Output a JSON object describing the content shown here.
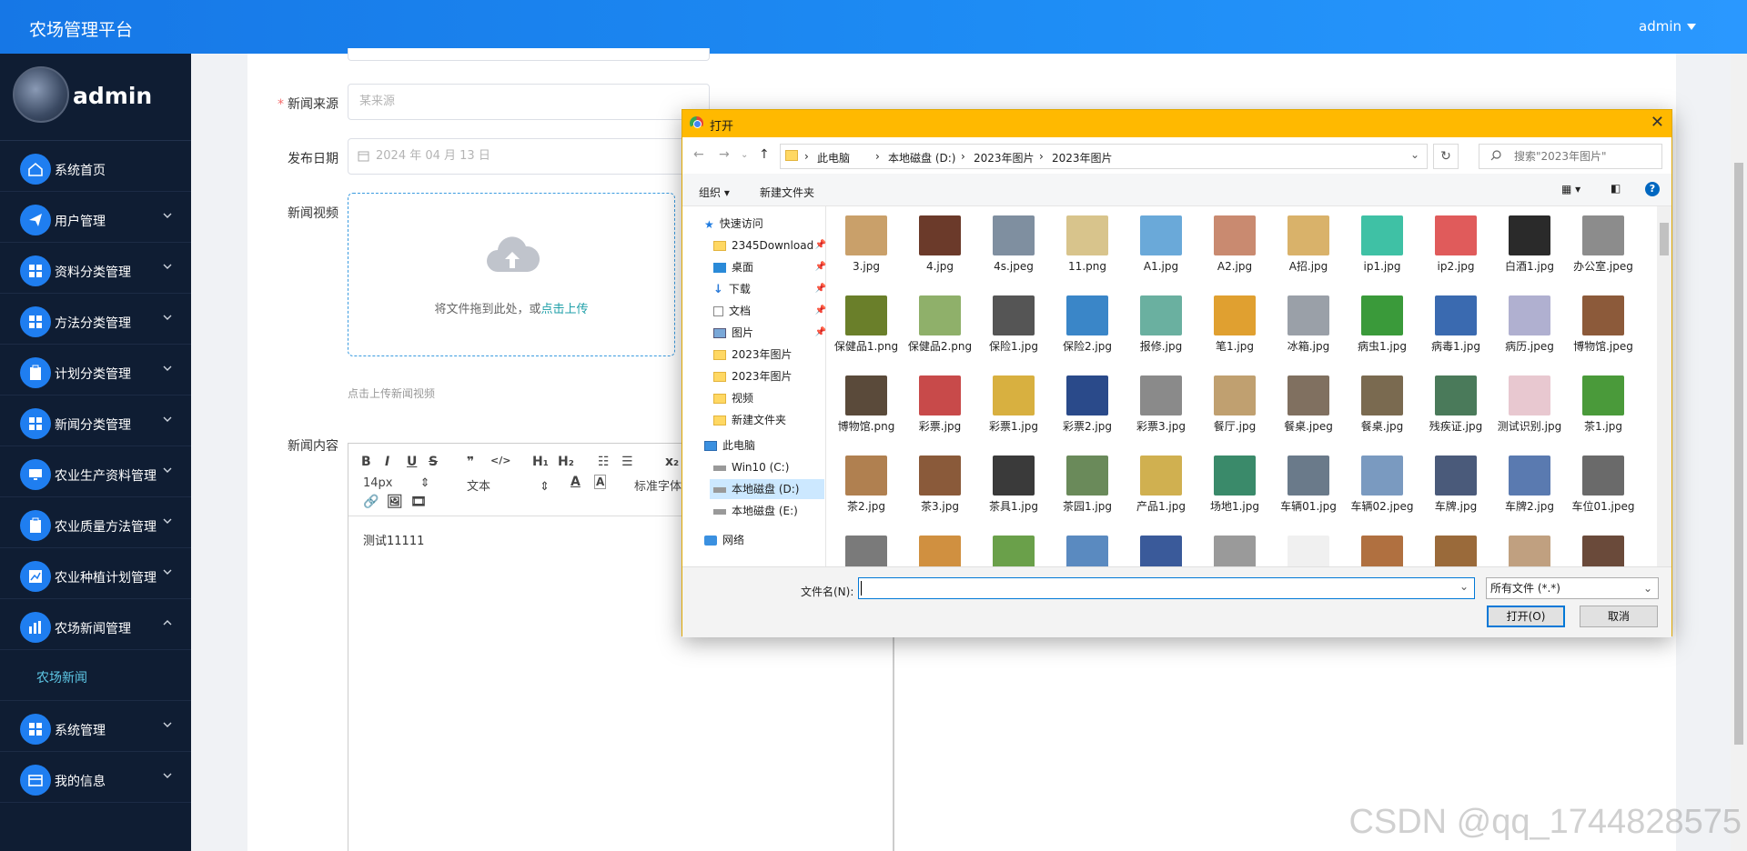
{
  "topbar": {
    "brand": "农场管理平台",
    "user": "admin"
  },
  "sidebar": {
    "profile_name": "admin",
    "items": [
      {
        "label": "系统首页",
        "icon": "home-icon"
      },
      {
        "label": "用户管理",
        "icon": "send-icon"
      },
      {
        "label": "资料分类管理",
        "icon": "grid-icon"
      },
      {
        "label": "方法分类管理",
        "icon": "grid-icon"
      },
      {
        "label": "计划分类管理",
        "icon": "clipboard-icon"
      },
      {
        "label": "新闻分类管理",
        "icon": "grid-icon"
      },
      {
        "label": "农业生产资料管理",
        "icon": "monitor-icon"
      },
      {
        "label": "农业质量方法管理",
        "icon": "clipboard-icon"
      },
      {
        "label": "农业种植计划管理",
        "icon": "chart-icon"
      },
      {
        "label": "农场新闻管理",
        "icon": "chart-bar-icon"
      }
    ],
    "sub_item": "农场新闻",
    "after_items": [
      {
        "label": "系统管理",
        "icon": "grid-icon"
      },
      {
        "label": "我的信息",
        "icon": "card-icon"
      }
    ]
  },
  "form": {
    "source_label": "新闻来源",
    "source_placeholder": "某来源",
    "date_label": "发布日期",
    "date_value": "2024 年 04 月 13 日",
    "video_label": "新闻视频",
    "upload_text": "将文件拖到此处，或",
    "upload_link": "点击上传",
    "upload_tip": "点击上传新闻视频",
    "content_label": "新闻内容",
    "editor_font_size": "14px",
    "editor_text_type": "文本",
    "editor_font_family": "标准字体",
    "editor_content": "测试11111"
  },
  "dialog": {
    "title": "打开",
    "breadcrumbs": [
      "此电脑",
      "本地磁盘 (D:)",
      "2023年图片",
      "2023年图片"
    ],
    "search_placeholder": "搜索\"2023年图片\"",
    "organize": "组织 ▾",
    "new_folder": "新建文件夹",
    "tree": [
      {
        "label": "快速访问",
        "type": "star",
        "indent": 0
      },
      {
        "label": "2345Download",
        "type": "folder",
        "indent": 1,
        "pin": true
      },
      {
        "label": "桌面",
        "type": "desktop",
        "indent": 1,
        "pin": true
      },
      {
        "label": "下载",
        "type": "download",
        "indent": 1,
        "pin": true
      },
      {
        "label": "文档",
        "type": "doc",
        "indent": 1,
        "pin": true
      },
      {
        "label": "图片",
        "type": "pic",
        "indent": 1,
        "pin": true
      },
      {
        "label": "2023年图片",
        "type": "folder",
        "indent": 1
      },
      {
        "label": "2023年图片",
        "type": "folder",
        "indent": 1
      },
      {
        "label": "视频",
        "type": "folder",
        "indent": 1
      },
      {
        "label": "新建文件夹",
        "type": "folder",
        "indent": 1
      },
      {
        "label": "此电脑",
        "type": "pc",
        "indent": 0
      },
      {
        "label": "Win10 (C:)",
        "type": "drive",
        "indent": 1
      },
      {
        "label": "本地磁盘 (D:)",
        "type": "drive",
        "indent": 1,
        "selected": true
      },
      {
        "label": "本地磁盘 (E:)",
        "type": "drive",
        "indent": 1
      },
      {
        "label": "网络",
        "type": "net",
        "indent": 0
      }
    ],
    "files": [
      [
        "3.jpg",
        "4.jpg",
        "4s.jpeg",
        "11.png",
        "A1.jpg",
        "A2.jpg",
        "A招.jpg",
        "ip1.jpg",
        "ip2.jpg",
        "白酒1.jpg",
        "办公室.jpeg"
      ],
      [
        "保健品1.png",
        "保健品2.png",
        "保险1.jpg",
        "保险2.jpg",
        "报修.jpg",
        "笔1.jpg",
        "冰箱.jpg",
        "病虫1.jpg",
        "病毒1.jpg",
        "病历.jpeg",
        "博物馆.jpeg"
      ],
      [
        "博物馆.png",
        "彩票.jpg",
        "彩票1.jpg",
        "彩票2.jpg",
        "彩票3.jpg",
        "餐厅.jpg",
        "餐桌.jpeg",
        "餐桌.jpg",
        "残疾证.jpg",
        "测试识别.jpg",
        "茶1.jpg"
      ],
      [
        "茶2.jpg",
        "茶3.jpg",
        "茶具1.jpg",
        "茶园1.jpg",
        "产品1.jpg",
        "场地1.jpg",
        "车辆01.jpg",
        "车辆02.jpeg",
        "车牌.jpg",
        "车牌2.jpg",
        "车位01.jpeg"
      ]
    ],
    "thumb_colors": [
      [
        "#c9a06a",
        "#6b3a2a",
        "#7f8fa0",
        "#d8c48c",
        "#6aa9d9",
        "#c98a70",
        "#d9b26a",
        "#3fc1a5",
        "#e05b5b",
        "#2a2a2a",
        "#8c8c8c"
      ],
      [
        "#6a7f2a",
        "#8fb06a",
        "#555555",
        "#3a86c8",
        "#6ab0a0",
        "#e0a030",
        "#9aa0a8",
        "#3a9a3a",
        "#3a6ab0",
        "#b0b0d0",
        "#8c5a3a"
      ],
      [
        "#5a4a3a",
        "#c84a4a",
        "#d8b040",
        "#2a4a8a",
        "#8a8a8a",
        "#c0a070",
        "#807060",
        "#7a6a50",
        "#4a7a5a",
        "#e8c8d0",
        "#4a9a3a"
      ],
      [
        "#b08050",
        "#8a5a3a",
        "#3a3a3a",
        "#6a8a5a",
        "#d0b050",
        "#3a8a6a",
        "#6a7a8a",
        "#7a9ac0",
        "#4a5a7a",
        "#5a7ab0",
        "#6a6a6a"
      ],
      [
        "#7a7a7a",
        "#d09040",
        "#6aa04a",
        "#5a8ac0",
        "#3a5a9a",
        "#9a9a9a",
        "#f0f0f0",
        "#b07040",
        "#9a6a3a",
        "#c0a080",
        "#6a4a3a"
      ]
    ],
    "filename_label": "文件名(N):",
    "filename_value": "",
    "file_type": "所有文件 (*.*)",
    "open_btn": "打开(O)",
    "cancel_btn": "取消"
  },
  "watermark": "CSDN @qq_1744828575",
  "colors": {
    "accent": "#1e8df5",
    "sidebar_bg": "#0f1d33",
    "dialog_title": "#ffb900"
  }
}
